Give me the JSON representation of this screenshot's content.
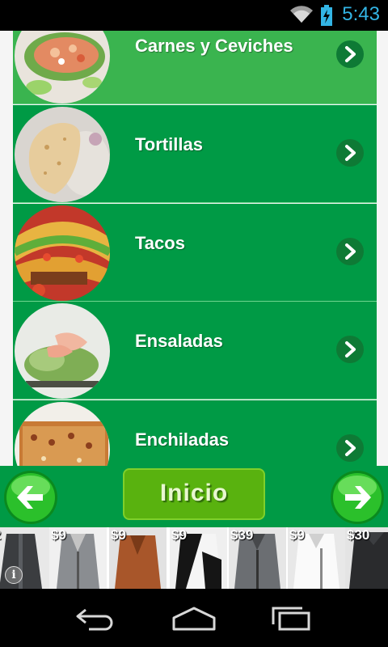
{
  "status": {
    "time": "5:43",
    "icons": [
      "wifi-icon",
      "battery-charging-icon"
    ]
  },
  "colors": {
    "list_green": "#009a45",
    "highlight_green": "#3ab44f",
    "inicio_green": "#59b20f",
    "status_blue": "#33b5e5"
  },
  "menu": {
    "items": [
      {
        "label": "Carnes y Ceviches",
        "icon": "chevron-right-icon",
        "highlighted": true
      },
      {
        "label": "Tortillas",
        "icon": "chevron-right-icon",
        "highlighted": false
      },
      {
        "label": "Tacos",
        "icon": "chevron-right-icon",
        "highlighted": false
      },
      {
        "label": "Ensaladas",
        "icon": "chevron-right-icon",
        "highlighted": false
      },
      {
        "label": "Enchiladas",
        "icon": "chevron-right-icon",
        "highlighted": false
      }
    ]
  },
  "nav": {
    "back_icon": "arrow-left-icon",
    "home_label": "Inicio",
    "forward_icon": "arrow-right-icon"
  },
  "ad": {
    "prices": [
      "2",
      "$9",
      "$9",
      "$9",
      "$39",
      "$9",
      "$30"
    ],
    "info_glyph": "i"
  },
  "system_nav": {
    "icons": [
      "back-icon",
      "home-icon",
      "recents-icon"
    ]
  }
}
